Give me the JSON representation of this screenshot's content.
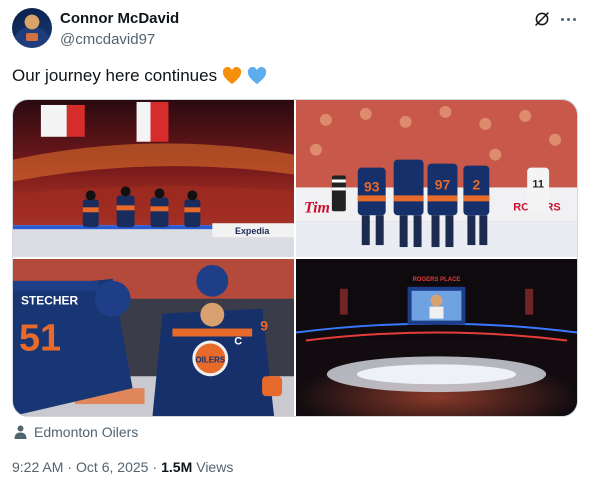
{
  "author": {
    "name": "Connor McDavid",
    "handle": "@cmcdavid97"
  },
  "post": {
    "text": "Our journey here continues",
    "emojis": [
      "orange-heart-icon",
      "blue-heart-icon"
    ],
    "media_count": 4
  },
  "media": {
    "tile_1": {
      "board_text": "Expedia"
    },
    "tile_2": {
      "board_text_left": "Tim",
      "board_text_right": "ROGERS",
      "jerseys": [
        "93",
        "97",
        "2",
        "11"
      ]
    },
    "tile_3": {
      "jerseys": [
        "51",
        "C",
        "9"
      ],
      "name_bar": "STECHER",
      "logo": "OILERS"
    },
    "tile_4": {
      "sign": "ROGERS PLACE"
    }
  },
  "location": {
    "label": "Edmonton Oilers",
    "icon": "person-icon"
  },
  "meta": {
    "time": "9:22 AM",
    "separator": "·",
    "date": "Oct 6, 2025",
    "views_count": "1.5M",
    "views_label": "Views"
  },
  "colors": {
    "text_primary": "#0f1419",
    "text_secondary": "#536471",
    "border": "#cfd9de",
    "orange_heart": "#f4900c",
    "blue_heart": "#5dadec"
  }
}
